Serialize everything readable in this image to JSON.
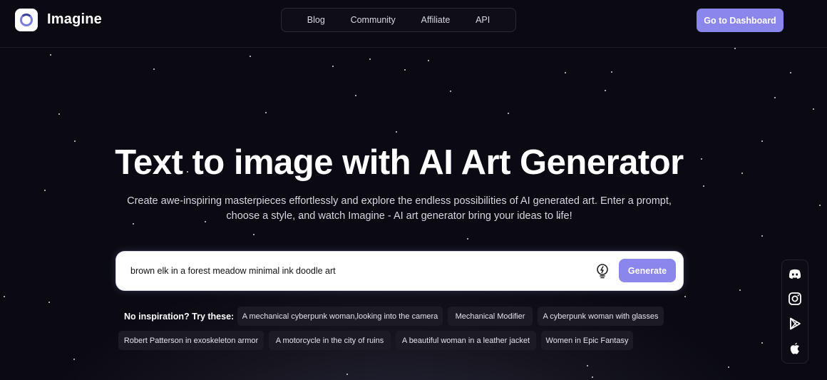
{
  "header": {
    "brand": "Imagine",
    "nav": [
      "Blog",
      "Community",
      "Affiliate",
      "API"
    ],
    "dashboard_label": "Go to Dashboard"
  },
  "hero": {
    "title": "Text to image with AI Art Generator",
    "subtitle": "Create awe-inspiring masterpieces effortlessly and explore the endless possibilities of AI generated art. Enter a prompt, choose a style, and watch Imagine - AI art generator bring your ideas to life!"
  },
  "prompt": {
    "value": "brown elk in a forest meadow minimal ink doodle art",
    "generate_label": "Generate"
  },
  "suggestions": {
    "label": "No inspiration? Try these:",
    "chips": [
      "A mechanical cyberpunk woman,looking into the camera",
      "Mechanical Modifier",
      "A cyberpunk woman with glasses",
      "Robert Patterson in exoskeleton armor",
      "A motorcycle in the city of ruins",
      "A beautiful woman in a leather jacket",
      "Women in Epic Fantasy"
    ]
  },
  "social": {
    "icons": [
      "discord-icon",
      "instagram-icon",
      "google-play-icon",
      "apple-icon"
    ]
  },
  "colors": {
    "accent": "#8b86ec",
    "background": "#0b0a12",
    "chip_bg": "#1b1a25"
  }
}
